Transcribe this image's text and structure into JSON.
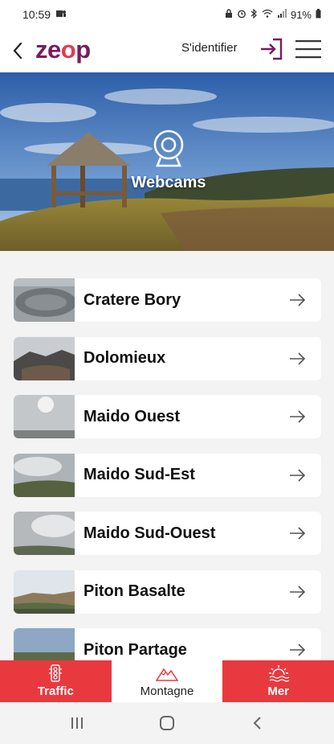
{
  "status": {
    "time": "10:59",
    "battery": "91%"
  },
  "header": {
    "logo_prefix": "ze",
    "logo_o": "o",
    "logo_suffix": "p",
    "login_label": "S'identifier"
  },
  "hero": {
    "title": "Webcams"
  },
  "webcams": [
    {
      "name": "Cratere Bory"
    },
    {
      "name": "Dolomieux"
    },
    {
      "name": "Maido Ouest"
    },
    {
      "name": "Maido Sud-Est"
    },
    {
      "name": "Maido Sud-Ouest"
    },
    {
      "name": "Piton Basalte"
    },
    {
      "name": "Piton Partage"
    }
  ],
  "tabs": [
    {
      "label": "Traffic",
      "icon": "traffic-light-icon"
    },
    {
      "label": "Montagne",
      "icon": "mountain-icon"
    },
    {
      "label": "Mer",
      "icon": "sun-sea-icon"
    }
  ],
  "colors": {
    "brand_purple": "#7a1b5d",
    "brand_red": "#e23b4e",
    "tab_red": "#e8393f"
  }
}
